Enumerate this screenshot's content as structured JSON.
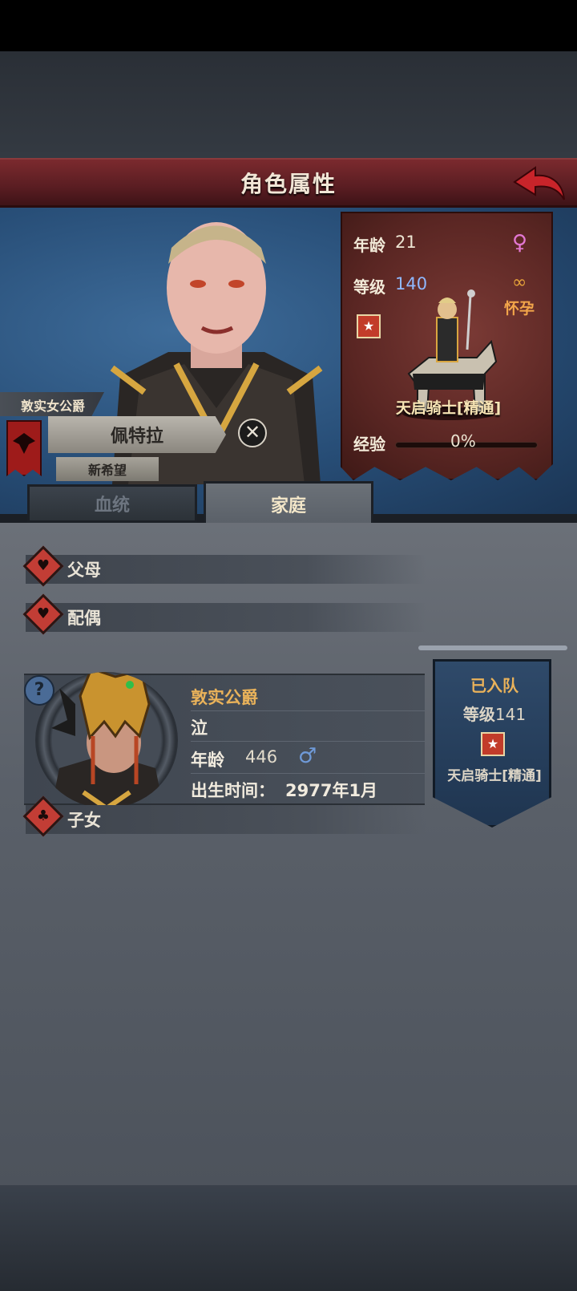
{
  "header": {
    "title": "角色属性"
  },
  "character": {
    "title": "敦实女公爵",
    "name": "佩特拉",
    "faction": "新希望",
    "age_label": "年龄",
    "age": "21",
    "level_label": "等级",
    "level": "140",
    "status": "怀孕",
    "class_name": "天启骑士[精通]",
    "exp_label": "经验",
    "exp_value": "0%"
  },
  "tabs": [
    {
      "label": "血统",
      "active": false
    },
    {
      "label": "家庭",
      "active": true
    }
  ],
  "sections": {
    "parents": "父母",
    "spouse": "配偶",
    "children": "子女"
  },
  "spouse": {
    "title": "敦实公爵",
    "name": "泣",
    "age_label": "年龄",
    "age": "446",
    "birth_label": "出生时间：",
    "birth_value": "2977年1月",
    "team_status": "已入队",
    "level_label": "等级",
    "level": "141",
    "class_name": "天启骑士[精通]"
  },
  "colors": {
    "title_bar": "#6a2428",
    "accent_gold": "#e9b25a",
    "level_blue": "#8fb8ff",
    "female": "#e377d3",
    "male": "#6f9ad8"
  }
}
